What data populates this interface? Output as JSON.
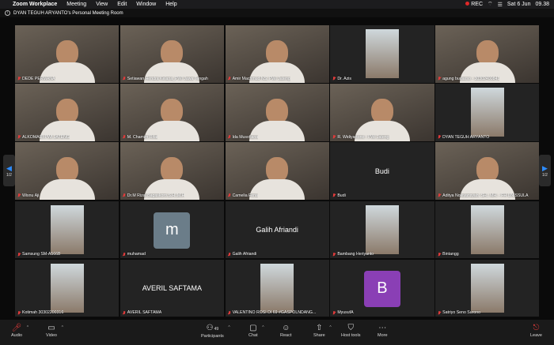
{
  "menubar": {
    "items": [
      "Zoom Workplace",
      "Meeting",
      "View",
      "Edit",
      "Window",
      "Help"
    ],
    "rec_label": "REC",
    "date": "Sat 6 Jun",
    "time": "09.38"
  },
  "titlebar": {
    "title": "DYAN TEGUH ARYANTO's Personal Meeting Room"
  },
  "pager": {
    "left": "1/2",
    "right": "1/2"
  },
  "tiles": [
    {
      "name": "DEDE PERMANA",
      "kind": "video"
    },
    {
      "name": "Setiawan Hendra Kelana_PWI Jawa Tengah",
      "kind": "video"
    },
    {
      "name": "Amir Machmud NS, PWI Jateng",
      "kind": "video"
    },
    {
      "name": "Dr. Azis",
      "kind": "small"
    },
    {
      "name": "agung budiarso - 30302400841",
      "kind": "video"
    },
    {
      "name": "ALKOMARI-PWI JATENG",
      "kind": "video"
    },
    {
      "name": "M. Chamim Rifai",
      "kind": "video"
    },
    {
      "name": "Ida Musofiana",
      "kind": "video"
    },
    {
      "name": "R. Widiyartono - PWi Jateng",
      "kind": "video"
    },
    {
      "name": "DYAN TEGUH ARYANTO",
      "kind": "small"
    },
    {
      "name": "Wisnu Aji",
      "kind": "video"
    },
    {
      "name": "Dr.M Rizal Bagaskoro,S.H.,M.H",
      "kind": "video"
    },
    {
      "name": "Camelia Fena",
      "kind": "video"
    },
    {
      "name": "Budi",
      "kind": "name",
      "center": "Budi"
    },
    {
      "name": "Aditya Noviyansyah, SH., MH. - FH UNISSULA",
      "kind": "video"
    },
    {
      "name": "Samsung SM-A566B",
      "kind": "small"
    },
    {
      "name": "muhamad",
      "kind": "avatar",
      "letter": "m",
      "color": "#6b7d89"
    },
    {
      "name": "Galih Afriandi",
      "kind": "name",
      "center": "Galih Afriandi"
    },
    {
      "name": "Bambang Heriyanto",
      "kind": "small"
    },
    {
      "name": "Bintangg",
      "kind": "small"
    },
    {
      "name": "Kotimah 30302200316",
      "kind": "small"
    },
    {
      "name": "AVERIL SAFTAMA",
      "kind": "name",
      "center": "AVERIL SAFTAMA"
    },
    {
      "name": "VALENTINO ROSI DI 69 #GASPOLNDANG...",
      "kind": "small"
    },
    {
      "name": "MyusufA",
      "kind": "avatar",
      "letter": "B",
      "color": "#8a3fb5"
    },
    {
      "name": "Satriyo Seno Surono",
      "kind": "small"
    }
  ],
  "toolbar": {
    "audio": "Audio",
    "video": "Video",
    "participants": "Participants",
    "participants_count": "49",
    "chat": "Chat",
    "react": "React",
    "share": "Share",
    "host_tools": "Host tools",
    "more": "More",
    "leave": "Leave"
  },
  "colors": {
    "muted": "#e23b3b",
    "accent": "#2d8cff"
  }
}
